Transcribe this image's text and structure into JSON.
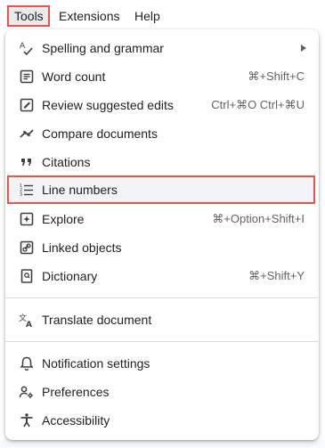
{
  "menubar": {
    "items": [
      {
        "label": "Tools"
      },
      {
        "label": "Extensions"
      },
      {
        "label": "Help"
      }
    ]
  },
  "tools_menu": {
    "items": [
      {
        "label": "Spelling and grammar",
        "shortcut": "",
        "icon": "spellcheck-icon",
        "has_submenu": true
      },
      {
        "label": "Word count",
        "shortcut": "⌘+Shift+C",
        "icon": "word-count-icon"
      },
      {
        "label": "Review suggested edits",
        "shortcut": "Ctrl+⌘O Ctrl+⌘U",
        "icon": "review-edits-icon"
      },
      {
        "label": "Compare documents",
        "shortcut": "",
        "icon": "compare-icon"
      },
      {
        "label": "Citations",
        "shortcut": "",
        "icon": "quote-icon"
      },
      {
        "label": "Line numbers",
        "shortcut": "",
        "icon": "line-numbers-icon",
        "highlighted": true
      },
      {
        "label": "Explore",
        "shortcut": "⌘+Option+Shift+I",
        "icon": "explore-icon"
      },
      {
        "label": "Linked objects",
        "shortcut": "",
        "icon": "link-icon"
      },
      {
        "label": "Dictionary",
        "shortcut": "⌘+Shift+Y",
        "icon": "dictionary-icon"
      },
      {
        "label": "Translate document",
        "shortcut": "",
        "icon": "translate-icon"
      },
      {
        "label": "Notification settings",
        "shortcut": "",
        "icon": "bell-icon"
      },
      {
        "label": "Preferences",
        "shortcut": "",
        "icon": "preferences-icon"
      },
      {
        "label": "Accessibility",
        "shortcut": "",
        "icon": "accessibility-icon"
      }
    ]
  },
  "colors": {
    "highlight_border": "#e9554a",
    "text": "#202124",
    "shortcut_text": "#5f6368",
    "divider": "#dadce0"
  }
}
